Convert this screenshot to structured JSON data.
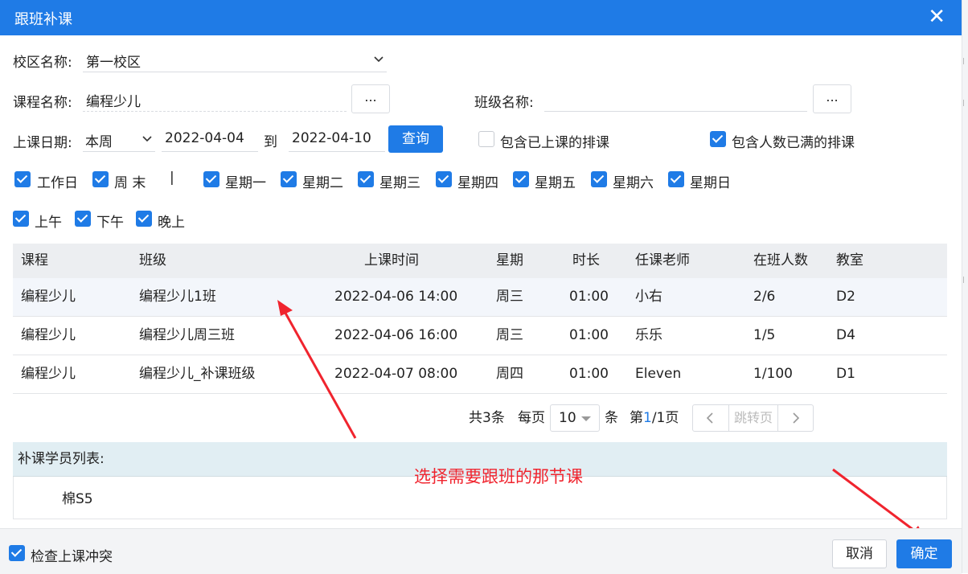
{
  "dialog": {
    "title": "跟班补课",
    "close_icon": "close-icon"
  },
  "filters": {
    "campus": {
      "label": "校区名称:",
      "value": "第一校区"
    },
    "course": {
      "label": "课程名称:",
      "value": "编程少儿",
      "picker_label": "..."
    },
    "class": {
      "label": "班级名称:",
      "value": "",
      "picker_label": "..."
    },
    "date": {
      "label": "上课日期:",
      "range": "本周",
      "start": "2022-04-04",
      "to": "到",
      "end": "2022-04-10",
      "query_label": "查询"
    },
    "include_taught": {
      "label": "包含已上课的排课",
      "checked": false
    },
    "include_full": {
      "label": "包含人数已满的排课",
      "checked": true
    },
    "day_groups": [
      {
        "label": "工作日",
        "checked": true
      },
      {
        "label": "周 末",
        "checked": true
      }
    ],
    "separator": "|",
    "weekdays": [
      {
        "label": "星期一",
        "checked": true
      },
      {
        "label": "星期二",
        "checked": true
      },
      {
        "label": "星期三",
        "checked": true
      },
      {
        "label": "星期四",
        "checked": true
      },
      {
        "label": "星期五",
        "checked": true
      },
      {
        "label": "星期六",
        "checked": true
      },
      {
        "label": "星期日",
        "checked": true
      }
    ],
    "periods": [
      {
        "label": "上午",
        "checked": true
      },
      {
        "label": "下午",
        "checked": true
      },
      {
        "label": "晚上",
        "checked": true
      }
    ]
  },
  "table": {
    "columns": [
      "课程",
      "班级",
      "上课时间",
      "星期",
      "时长",
      "任课老师",
      "在班人数",
      "教室"
    ],
    "rows": [
      [
        "编程少儿",
        "编程少儿1班",
        "2022-04-06 14:00",
        "周三",
        "01:00",
        "小右",
        "2/6",
        "D2"
      ],
      [
        "编程少儿",
        "编程少儿周三班",
        "2022-04-06 16:00",
        "周三",
        "01:00",
        "乐乐",
        "1/5",
        "D4"
      ],
      [
        "编程少儿",
        "编程少儿_补课班级",
        "2022-04-07 08:00",
        "周四",
        "01:00",
        "Eleven",
        "1/100",
        "D1"
      ]
    ],
    "selected_row": 0
  },
  "pagination": {
    "total": "共3条",
    "per_page_label": "每页",
    "per_page": "10",
    "unit": "条",
    "page_prefix": "第",
    "current_page": "1",
    "page_suffix": "/1页",
    "jump_placeholder": "跳转页"
  },
  "students": {
    "header": "补课学员列表:",
    "items": [
      "棉S5"
    ]
  },
  "footer": {
    "check_conflict": {
      "label": "检查上课冲突",
      "checked": true
    },
    "cancel_label": "取消",
    "ok_label": "确定"
  },
  "annotation": {
    "text": "选择需要跟班的那节课",
    "color": "#f0242e"
  },
  "colors": {
    "primary": "#1f7be6",
    "header_bg": "#eceef1",
    "students_bg": "#e1eef3"
  }
}
